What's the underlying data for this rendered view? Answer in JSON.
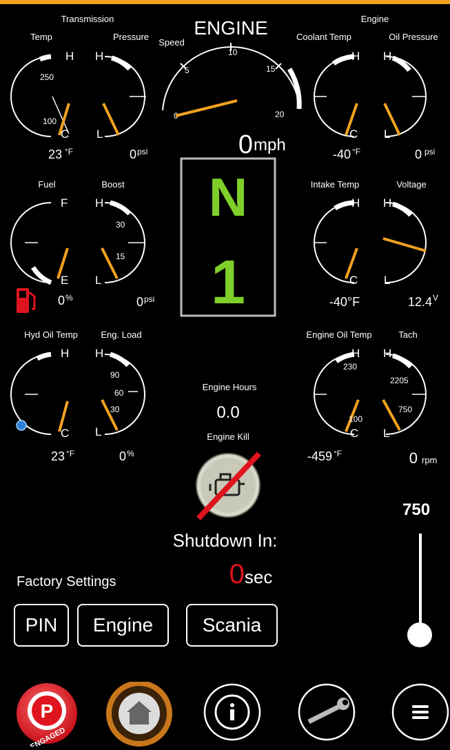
{
  "app": {
    "accent": "#f2a21f",
    "needle": "#f2a21f",
    "warn_red": "#e0141e",
    "gear_green": "#7fcf2a"
  },
  "header": {
    "left_group": "Transmission",
    "center_title": "ENGINE",
    "right_group": "Engine"
  },
  "gauges": {
    "trans_temp": {
      "label": "Temp",
      "top": "H",
      "bottom": "C",
      "tick1": "250",
      "tick2": "100",
      "value": "23",
      "unit": "°F"
    },
    "trans_pressure": {
      "label": "Pressure",
      "top": "H",
      "bottom": "L",
      "value": "0",
      "unit": "psi"
    },
    "coolant": {
      "label": "Coolant Temp",
      "top": "H",
      "bottom": "C",
      "value": "-40",
      "unit": "°F"
    },
    "oil_pressure": {
      "label": "Oil Pressure",
      "top": "H",
      "bottom": "L",
      "value": "0",
      "unit": "psi"
    },
    "fuel": {
      "label": "Fuel",
      "top": "F",
      "bottom": "E",
      "value": "0",
      "unit": "%"
    },
    "boost": {
      "label": "Boost",
      "top": "H",
      "bottom": "L",
      "tick1": "30",
      "tick2": "15",
      "value": "0",
      "unit": "psi"
    },
    "intake": {
      "label": "Intake Temp",
      "top": "H",
      "bottom": "C",
      "value": "-40°F",
      "unit": ""
    },
    "voltage": {
      "label": "Voltage",
      "top": "H",
      "bottom": "L",
      "value": "12.4",
      "unit": "V"
    },
    "hyd_oil": {
      "label": "Hyd Oil Temp",
      "top": "H",
      "bottom": "C",
      "value": "23",
      "unit": "°F"
    },
    "eng_load": {
      "label": "Eng. Load",
      "top": "H",
      "bottom": "L",
      "tick1": "90",
      "tick2": "60",
      "tick3": "30",
      "value": "0",
      "unit": "%"
    },
    "eng_oil_temp": {
      "label": "Engine Oil Temp",
      "top": "H",
      "bottom": "C",
      "tick1": "230",
      "tick2": "100",
      "value": "-459",
      "unit": "°F"
    },
    "tach": {
      "label": "Tach",
      "top": "H",
      "bottom": "L",
      "tick1": "2205",
      "tick2": "750",
      "value": "0",
      "unit": "rpm"
    }
  },
  "speedo": {
    "label": "Speed",
    "ticks": [
      "0",
      "5",
      "10",
      "15",
      "20"
    ],
    "value": "0",
    "unit": "mph"
  },
  "gear": {
    "selector": "N",
    "gear_number": "1"
  },
  "engine_hours": {
    "label": "Engine Hours",
    "value": "0.0"
  },
  "engine_kill": {
    "label": "Engine Kill"
  },
  "shutdown": {
    "label": "Shutdown In:",
    "value": "0",
    "unit": "sec"
  },
  "throttle": {
    "value": "750"
  },
  "factory": {
    "label": "Factory Settings",
    "buttons": [
      "PIN",
      "Engine",
      "Scania"
    ]
  },
  "nav": {
    "park_letter": "P",
    "park_status": "ENGAGED"
  }
}
